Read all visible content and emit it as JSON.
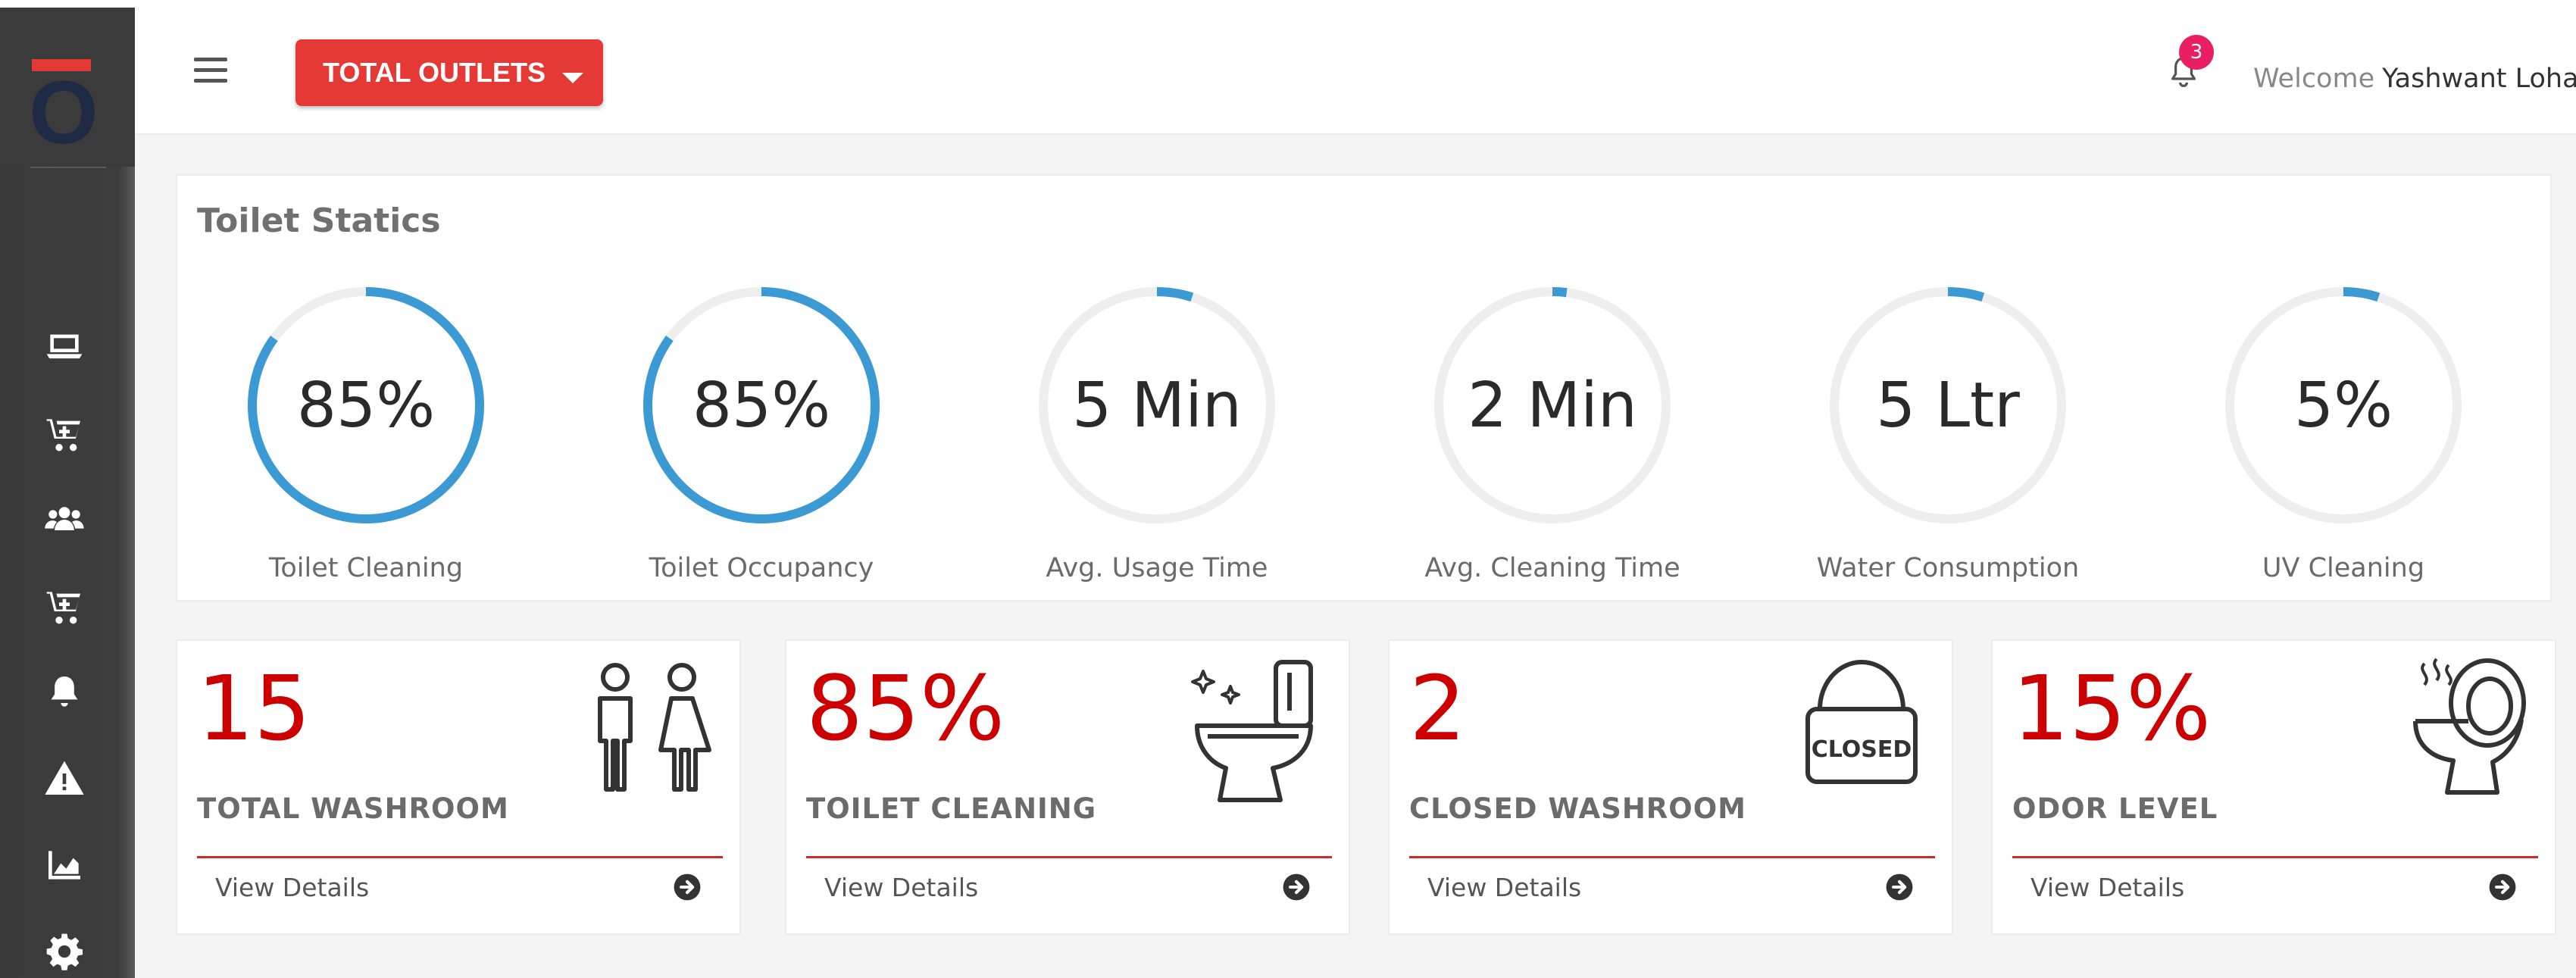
{
  "header": {
    "outlets_label": "TOTAL OUTLETS",
    "notification_count": "3",
    "welcome_prefix": "Welcome",
    "user_name": "Yashwant Lohar"
  },
  "sidebar": {
    "icons": [
      "laptop-icon",
      "cart-icon",
      "users-icon",
      "cart-icon",
      "bell-icon",
      "warning-icon",
      "area-chart-icon",
      "gear-icon"
    ]
  },
  "statics": {
    "title": "Toilet Statics",
    "gauges": [
      {
        "value": "85%",
        "label": "Toilet Cleaning",
        "fill": 0.85
      },
      {
        "value": "85%",
        "label": "Toilet Occupancy",
        "fill": 0.85
      },
      {
        "value": "5 Min",
        "label": "Avg. Usage Time",
        "fill": 0.05
      },
      {
        "value": "2 Min",
        "label": "Avg. Cleaning Time",
        "fill": 0.02
      },
      {
        "value": "5 Ltr",
        "label": "Water Consumption",
        "fill": 0.05
      },
      {
        "value": "5%",
        "label": "UV Cleaning",
        "fill": 0.05
      }
    ]
  },
  "cards": [
    {
      "value": "15",
      "label": "TOTAL WASHROOM",
      "link": "View Details",
      "icon": "washroom-people-icon"
    },
    {
      "value": "85%",
      "label": "TOILET CLEANING",
      "link": "View Details",
      "icon": "clean-toilet-icon"
    },
    {
      "value": "2",
      "label": "CLOSED WASHROOM",
      "link": "View Details",
      "icon": "closed-sign-icon",
      "icon_text": "CLOSED"
    },
    {
      "value": "15%",
      "label": "ODOR LEVEL",
      "link": "View Details",
      "icon": "odor-toilet-icon"
    }
  ],
  "colors": {
    "accent": "#e53935",
    "gauge_fill": "#3b9ad4",
    "gauge_track": "#eeeeee",
    "value_red": "#cc0000",
    "sidebar_bg": "#3d3d3d"
  }
}
